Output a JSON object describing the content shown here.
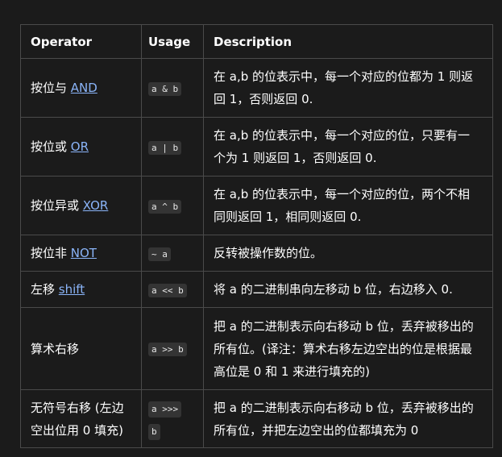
{
  "header": {
    "operator": "Operator",
    "usage": "Usage",
    "description": "Description"
  },
  "rows": [
    {
      "op_text": "按位与 ",
      "op_link": "AND",
      "usage": "a & b",
      "description": "在 a,b 的位表示中，每一个对应的位都为 1 则返回 1，否则返回 0."
    },
    {
      "op_text": "按位或 ",
      "op_link": "OR",
      "usage": "a | b",
      "description": "在 a,b 的位表示中，每一个对应的位，只要有一个为 1 则返回 1，否则返回 0."
    },
    {
      "op_text": "按位异或 ",
      "op_link": "XOR",
      "usage": "a ^ b",
      "description": "在 a,b 的位表示中，每一个对应的位，两个不相同则返回 1，相同则返回 0."
    },
    {
      "op_text": "按位非 ",
      "op_link": "NOT",
      "usage": "~ a",
      "description": "反转被操作数的位。"
    },
    {
      "op_text": "左移 ",
      "op_link": "shift",
      "usage": "a << b",
      "description": "将 a 的二进制串向左移动 b 位，右边移入 0."
    },
    {
      "op_text": "算术右移",
      "op_link": "",
      "usage": "a >> b",
      "description": "把 a 的二进制表示向右移动 b 位，丢弃被移出的所有位。(译注：算术右移左边空出的位是根据最高位是 0 和 1 来进行填充的)"
    },
    {
      "op_text": "无符号右移 (左边空出位用 0 填充)",
      "op_link": "",
      "usage_line1": "a >>>",
      "usage_line2": "b",
      "description": "把 a 的二进制表示向右移动 b 位，丢弃被移出的所有位，并把左边空出的位都填充为 0"
    }
  ]
}
